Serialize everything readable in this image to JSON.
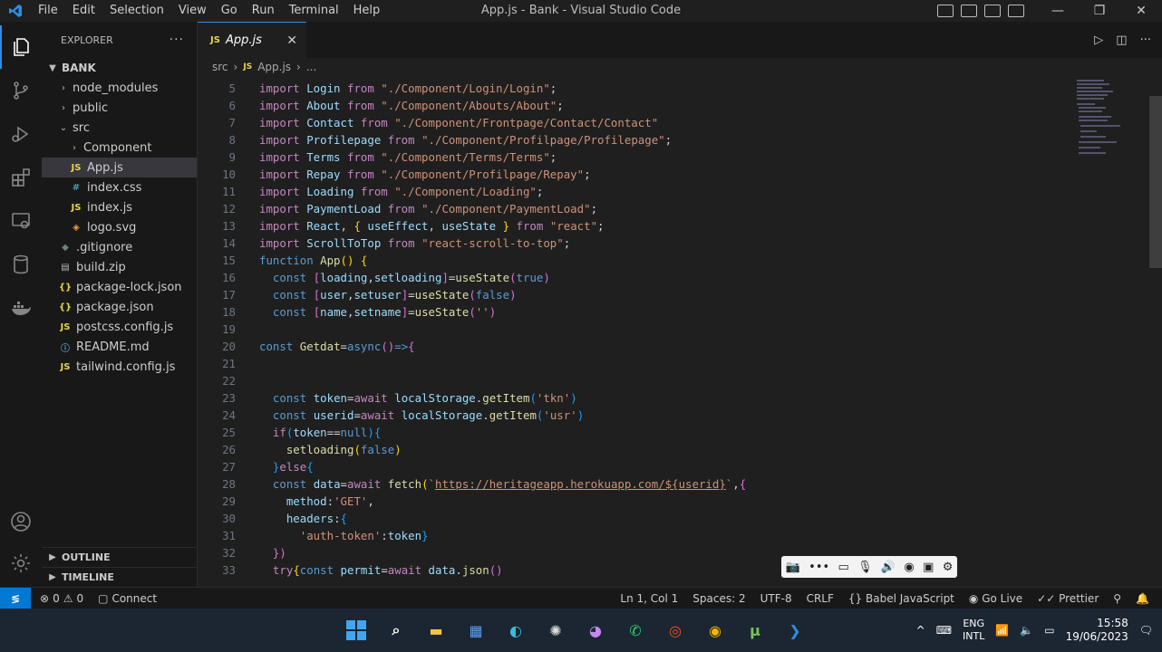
{
  "title_bar": {
    "window_title": "App.js - Bank - Visual Studio Code",
    "menu": [
      "File",
      "Edit",
      "Selection",
      "View",
      "Go",
      "Run",
      "Terminal",
      "Help"
    ],
    "minimize": "—",
    "restore": "❐",
    "close": "✕"
  },
  "explorer": {
    "header": "EXPLORER",
    "more": "···",
    "workspace": "BANK",
    "items": [
      {
        "label": "node_modules",
        "kind": "folder",
        "indent": 1,
        "expanded": false
      },
      {
        "label": "public",
        "kind": "folder",
        "indent": 1,
        "expanded": false
      },
      {
        "label": "src",
        "kind": "folder",
        "indent": 1,
        "expanded": true
      },
      {
        "label": "Component",
        "kind": "folder",
        "indent": 2,
        "expanded": false
      },
      {
        "label": "App.js",
        "kind": "js",
        "indent": 2,
        "selected": true
      },
      {
        "label": "index.css",
        "kind": "css",
        "indent": 2
      },
      {
        "label": "index.js",
        "kind": "js",
        "indent": 2
      },
      {
        "label": "logo.svg",
        "kind": "svg",
        "indent": 2
      },
      {
        "label": ".gitignore",
        "kind": "git",
        "indent": 1
      },
      {
        "label": "build.zip",
        "kind": "zip",
        "indent": 1
      },
      {
        "label": "package-lock.json",
        "kind": "json",
        "indent": 1
      },
      {
        "label": "package.json",
        "kind": "json",
        "indent": 1
      },
      {
        "label": "postcss.config.js",
        "kind": "js",
        "indent": 1
      },
      {
        "label": "README.md",
        "kind": "md",
        "indent": 1
      },
      {
        "label": "tailwind.config.js",
        "kind": "js",
        "indent": 1
      }
    ],
    "outline": "OUTLINE",
    "timeline": "TIMELINE"
  },
  "editor": {
    "tab": {
      "label": "App.js",
      "icon": "JS"
    },
    "breadcrumb": [
      "src",
      "App.js",
      "..."
    ],
    "lines": [
      {
        "n": "5",
        "segs": [
          [
            "kw",
            "import "
          ],
          [
            "var",
            "Login "
          ],
          [
            "kw",
            "from "
          ],
          [
            "str",
            "\"./Component/Login/Login\""
          ],
          [
            "pl",
            ";"
          ]
        ]
      },
      {
        "n": "6",
        "segs": [
          [
            "kw",
            "import "
          ],
          [
            "var",
            "About "
          ],
          [
            "kw",
            "from "
          ],
          [
            "str",
            "\"./Component/Abouts/About\""
          ],
          [
            "pl",
            ";"
          ]
        ]
      },
      {
        "n": "7",
        "segs": [
          [
            "kw",
            "import "
          ],
          [
            "var",
            "Contact "
          ],
          [
            "kw",
            "from "
          ],
          [
            "str",
            "\"./Component/Frontpage/Contact/Contact\""
          ]
        ]
      },
      {
        "n": "8",
        "segs": [
          [
            "kw",
            "import "
          ],
          [
            "var",
            "Profilepage "
          ],
          [
            "kw",
            "from "
          ],
          [
            "str",
            "\"./Component/Profilpage/Profilepage\""
          ],
          [
            "pl",
            ";"
          ]
        ]
      },
      {
        "n": "9",
        "segs": [
          [
            "kw",
            "import "
          ],
          [
            "var",
            "Terms "
          ],
          [
            "kw",
            "from "
          ],
          [
            "str",
            "\"./Component/Terms/Terms\""
          ],
          [
            "pl",
            ";"
          ]
        ]
      },
      {
        "n": "10",
        "segs": [
          [
            "kw",
            "import "
          ],
          [
            "var",
            "Repay "
          ],
          [
            "kw",
            "from "
          ],
          [
            "str",
            "\"./Component/Profilpage/Repay\""
          ],
          [
            "pl",
            ";"
          ]
        ]
      },
      {
        "n": "11",
        "segs": [
          [
            "kw",
            "import "
          ],
          [
            "var",
            "Loading "
          ],
          [
            "kw",
            "from "
          ],
          [
            "str",
            "\"./Component/Loading\""
          ],
          [
            "pl",
            ";"
          ]
        ]
      },
      {
        "n": "12",
        "segs": [
          [
            "kw",
            "import "
          ],
          [
            "var",
            "PaymentLoad "
          ],
          [
            "kw",
            "from "
          ],
          [
            "str",
            "\"./Component/PaymentLoad\""
          ],
          [
            "pl",
            ";"
          ]
        ]
      },
      {
        "n": "13",
        "segs": [
          [
            "kw",
            "import "
          ],
          [
            "var",
            "React"
          ],
          [
            "pl",
            ", "
          ],
          [
            "br",
            "{ "
          ],
          [
            "var",
            "useEffect"
          ],
          [
            "pl",
            ", "
          ],
          [
            "var",
            "useState "
          ],
          [
            "br",
            "} "
          ],
          [
            "kw",
            "from "
          ],
          [
            "str",
            "\"react\""
          ],
          [
            "pl",
            ";"
          ]
        ]
      },
      {
        "n": "14",
        "segs": [
          [
            "kw",
            "import "
          ],
          [
            "var",
            "ScrollToTop "
          ],
          [
            "kw",
            "from "
          ],
          [
            "str",
            "\"react-scroll-to-top\""
          ],
          [
            "pl",
            ";"
          ]
        ]
      },
      {
        "n": "15",
        "segs": [
          [
            "kb",
            "function "
          ],
          [
            "fn",
            "App"
          ],
          [
            "br",
            "() {"
          ]
        ]
      },
      {
        "n": "16",
        "segs": [
          [
            "pl",
            "  "
          ],
          [
            "kb",
            "const "
          ],
          [
            "bp",
            "["
          ],
          [
            "var",
            "loading"
          ],
          [
            "pl",
            ","
          ],
          [
            "var",
            "setloading"
          ],
          [
            "bp",
            "]"
          ],
          [
            "pl",
            "="
          ],
          [
            "fn",
            "useState"
          ],
          [
            "bp",
            "("
          ],
          [
            "kb",
            "true"
          ],
          [
            "bp",
            ")"
          ]
        ]
      },
      {
        "n": "17",
        "segs": [
          [
            "pl",
            "  "
          ],
          [
            "kb",
            "const "
          ],
          [
            "bp",
            "["
          ],
          [
            "var",
            "user"
          ],
          [
            "pl",
            ","
          ],
          [
            "var",
            "setuser"
          ],
          [
            "bp",
            "]"
          ],
          [
            "pl",
            "="
          ],
          [
            "fn",
            "useState"
          ],
          [
            "bp",
            "("
          ],
          [
            "kb",
            "false"
          ],
          [
            "bp",
            ")"
          ]
        ]
      },
      {
        "n": "18",
        "segs": [
          [
            "pl",
            "  "
          ],
          [
            "kb",
            "const "
          ],
          [
            "bp",
            "["
          ],
          [
            "var",
            "name"
          ],
          [
            "pl",
            ","
          ],
          [
            "var",
            "setname"
          ],
          [
            "bp",
            "]"
          ],
          [
            "pl",
            "="
          ],
          [
            "fn",
            "useState"
          ],
          [
            "bp",
            "("
          ],
          [
            "str",
            "''"
          ],
          [
            "bp",
            ")"
          ]
        ]
      },
      {
        "n": "19",
        "segs": []
      },
      {
        "n": "20",
        "segs": [
          [
            "kb",
            "const "
          ],
          [
            "fn",
            "Getdat"
          ],
          [
            "pl",
            "="
          ],
          [
            "kb",
            "async"
          ],
          [
            "bp",
            "()"
          ],
          [
            "kb",
            "=>"
          ],
          [
            "bp",
            "{"
          ]
        ]
      },
      {
        "n": "21",
        "segs": []
      },
      {
        "n": "22",
        "segs": []
      },
      {
        "n": "23",
        "segs": [
          [
            "pl",
            "  "
          ],
          [
            "kb",
            "const "
          ],
          [
            "var",
            "token"
          ],
          [
            "pl",
            "="
          ],
          [
            "kw",
            "await "
          ],
          [
            "var",
            "localStorage"
          ],
          [
            "pl",
            "."
          ],
          [
            "fn",
            "getItem"
          ],
          [
            "bb",
            "("
          ],
          [
            "str",
            "'tkn'"
          ],
          [
            "bb",
            ")"
          ]
        ]
      },
      {
        "n": "24",
        "segs": [
          [
            "pl",
            "  "
          ],
          [
            "kb",
            "const "
          ],
          [
            "var",
            "userid"
          ],
          [
            "pl",
            "="
          ],
          [
            "kw",
            "await "
          ],
          [
            "var",
            "localStorage"
          ],
          [
            "pl",
            "."
          ],
          [
            "fn",
            "getItem"
          ],
          [
            "bb",
            "("
          ],
          [
            "str",
            "'usr'"
          ],
          [
            "bb",
            ")"
          ]
        ]
      },
      {
        "n": "25",
        "segs": [
          [
            "pl",
            "  "
          ],
          [
            "kw",
            "if"
          ],
          [
            "bb",
            "("
          ],
          [
            "var",
            "token"
          ],
          [
            "pl",
            "=="
          ],
          [
            "kb",
            "null"
          ],
          [
            "bb",
            ")"
          ],
          [
            "bb",
            "{"
          ]
        ]
      },
      {
        "n": "26",
        "segs": [
          [
            "pl",
            "    "
          ],
          [
            "fn",
            "setloading"
          ],
          [
            "br",
            "("
          ],
          [
            "kb",
            "false"
          ],
          [
            "br",
            ")"
          ]
        ]
      },
      {
        "n": "27",
        "segs": [
          [
            "pl",
            "  "
          ],
          [
            "bb",
            "}"
          ],
          [
            "kw",
            "else"
          ],
          [
            "bb",
            "{"
          ]
        ]
      },
      {
        "n": "28",
        "segs": [
          [
            "pl",
            "  "
          ],
          [
            "kb",
            "const "
          ],
          [
            "var",
            "data"
          ],
          [
            "pl",
            "="
          ],
          [
            "kw",
            "await "
          ],
          [
            "fn",
            "fetch"
          ],
          [
            "br",
            "("
          ],
          [
            "str",
            "`"
          ],
          [
            "url",
            "https://heritageapp.herokuapp.com/${userid}"
          ],
          [
            "str",
            "`"
          ],
          [
            "pl",
            ","
          ],
          [
            "bp",
            "{"
          ]
        ]
      },
      {
        "n": "29",
        "segs": [
          [
            "pl",
            "    "
          ],
          [
            "var",
            "method"
          ],
          [
            "pl",
            ":"
          ],
          [
            "str",
            "'GET'"
          ],
          [
            "pl",
            ","
          ]
        ]
      },
      {
        "n": "30",
        "segs": [
          [
            "pl",
            "    "
          ],
          [
            "var",
            "headers"
          ],
          [
            "pl",
            ":"
          ],
          [
            "bb",
            "{"
          ]
        ]
      },
      {
        "n": "31",
        "segs": [
          [
            "pl",
            "      "
          ],
          [
            "str",
            "'auth-token'"
          ],
          [
            "pl",
            ":"
          ],
          [
            "var",
            "token"
          ],
          [
            "bb",
            "}"
          ]
        ]
      },
      {
        "n": "32",
        "segs": [
          [
            "pl",
            "  "
          ],
          [
            "bp",
            "})"
          ]
        ]
      },
      {
        "n": "33",
        "segs": [
          [
            "pl",
            "  "
          ],
          [
            "kw",
            "try"
          ],
          [
            "br",
            "{"
          ],
          [
            "kb",
            "const "
          ],
          [
            "var",
            "permit"
          ],
          [
            "pl",
            "="
          ],
          [
            "kw",
            "await "
          ],
          [
            "var",
            "data"
          ],
          [
            "pl",
            "."
          ],
          [
            "fn",
            "json"
          ],
          [
            "bp",
            "()"
          ]
        ]
      }
    ]
  },
  "status_bar": {
    "problems": "0",
    "warnings": "0",
    "connect": "Connect",
    "position": "Ln 1, Col 1",
    "spaces": "Spaces: 2",
    "encoding": "UTF-8",
    "eol": "CRLF",
    "language": "Babel JavaScript",
    "golive": "Go Live",
    "prettier": "Prettier"
  },
  "taskbar": {
    "lang_top": "ENG",
    "lang_bottom": "INTL",
    "time": "15:58",
    "date": "19/06/2023"
  }
}
